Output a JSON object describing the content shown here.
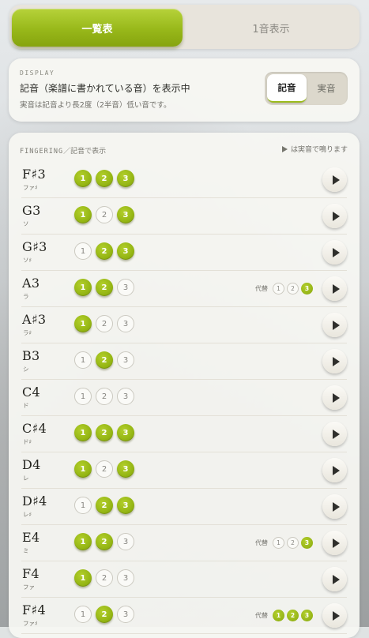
{
  "tabs": [
    {
      "label": "一覧表",
      "active": true
    },
    {
      "label": "1音表示",
      "active": false
    }
  ],
  "display": {
    "section_label": "DISPLAY",
    "main_text": "記音（楽譜に書かれている音）を表示中",
    "sub_text": "実音は記音より長2度（2半音）低い音です。",
    "toggle": {
      "selected": "記音",
      "options": [
        "記音",
        "実音"
      ]
    }
  },
  "fingering": {
    "section_label": "FINGERING",
    "section_label_suffix": "／記音で表示",
    "hint": "は実音で鳴ります",
    "alt_label": "代替",
    "accent_color": "#98b81a",
    "rows": [
      {
        "note": "F♯3",
        "kana": "ファ♯",
        "valves": [
          1,
          1,
          1
        ],
        "alt": null
      },
      {
        "note": "G3",
        "kana": "ソ",
        "valves": [
          1,
          0,
          1
        ],
        "alt": null
      },
      {
        "note": "G♯3",
        "kana": "ソ♯",
        "valves": [
          0,
          1,
          1
        ],
        "alt": null
      },
      {
        "note": "A3",
        "kana": "ラ",
        "valves": [
          1,
          1,
          0
        ],
        "alt": [
          0,
          0,
          1
        ]
      },
      {
        "note": "A♯3",
        "kana": "ラ♯",
        "valves": [
          1,
          0,
          0
        ],
        "alt": null
      },
      {
        "note": "B3",
        "kana": "シ",
        "valves": [
          0,
          1,
          0
        ],
        "alt": null
      },
      {
        "note": "C4",
        "kana": "ド",
        "valves": [
          0,
          0,
          0
        ],
        "alt": null
      },
      {
        "note": "C♯4",
        "kana": "ド♯",
        "valves": [
          1,
          1,
          1
        ],
        "alt": null
      },
      {
        "note": "D4",
        "kana": "レ",
        "valves": [
          1,
          0,
          1
        ],
        "alt": null
      },
      {
        "note": "D♯4",
        "kana": "レ♯",
        "valves": [
          0,
          1,
          1
        ],
        "alt": null
      },
      {
        "note": "E4",
        "kana": "ミ",
        "valves": [
          1,
          1,
          0
        ],
        "alt": [
          0,
          0,
          1
        ]
      },
      {
        "note": "F4",
        "kana": "ファ",
        "valves": [
          1,
          0,
          0
        ],
        "alt": null
      },
      {
        "note": "F♯4",
        "kana": "ファ♯",
        "valves": [
          0,
          1,
          0
        ],
        "alt": [
          1,
          1,
          1
        ]
      }
    ]
  }
}
